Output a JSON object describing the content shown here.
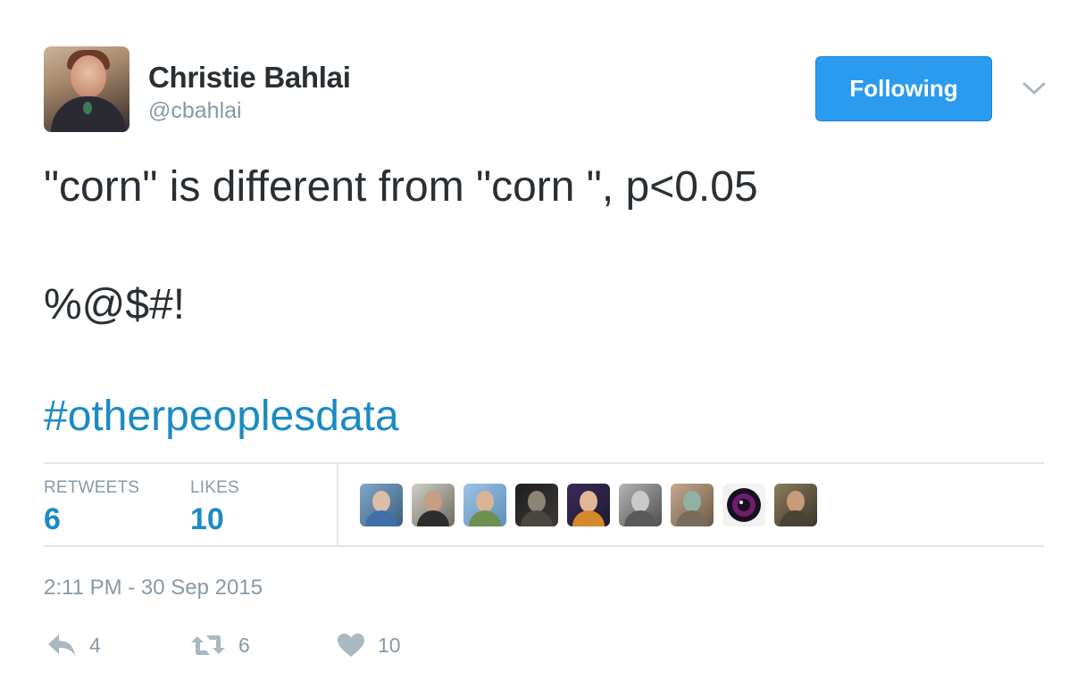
{
  "tweet": {
    "author": {
      "name": "Christie Bahlai",
      "handle": "@cbahlai"
    },
    "follow_button_label": "Following",
    "text_line1": "\"corn\" is different from \"corn \", p<0.05",
    "text_line2": "%@$#!",
    "hashtag": "#otherpeoplesdata",
    "stats": {
      "retweets_label": "RETWEETS",
      "retweets_value": "6",
      "likes_label": "LIKES",
      "likes_value": "10"
    },
    "timestamp": "2:11 PM - 30 Sep 2015",
    "actions": {
      "reply_count": "4",
      "retweet_count": "6",
      "like_count": "10"
    }
  },
  "colors": {
    "link_blue": "#1b8bc3",
    "follow_button_bg": "#2b9bf0",
    "muted_gray": "#8899a6",
    "text_dark": "#292f33",
    "divider": "#e1e8ed"
  },
  "icons": {
    "reply": "reply-icon",
    "retweet": "retweet-icon",
    "like": "heart-icon",
    "more": "chevron-down-icon"
  }
}
